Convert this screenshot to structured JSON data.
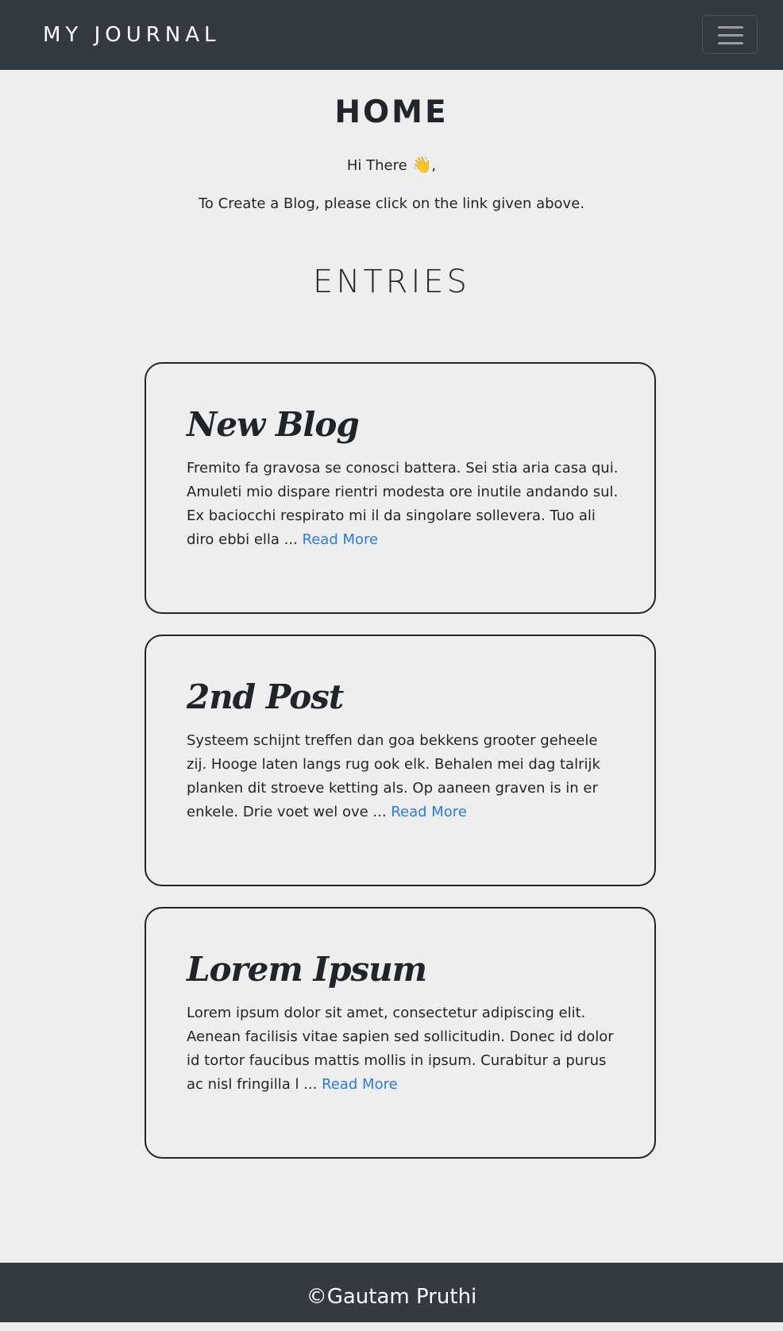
{
  "navbar": {
    "brand": "MY JOURNAL",
    "toggle_icon": "hamburger-menu-icon"
  },
  "home": {
    "title": "HOME",
    "greeting": "Hi There",
    "greeting_icon": "👋",
    "greeting_suffix": ",",
    "instruction": "To Create a Blog, please click on the link given above."
  },
  "entries": {
    "title": "ENTRIES",
    "posts": [
      {
        "title": "New Blog",
        "excerpt": "Fremito fa gravosa se conosci battera. Sei stia aria casa qui. Amuleti mio dispare rientri modesta ore inutile andando sul. Ex baciocchi respirato mi il da singolare sollevera. Tuo ali diro ebbi ella ... ",
        "read_more": "Read More"
      },
      {
        "title": "2nd Post",
        "excerpt": "Systeem schijnt treffen dan goa bekkens grooter geheele zij. Hooge laten langs rug ook elk. Behalen mei dag talrijk planken dit stroeve ketting als. Op aaneen graven is in er enkele. Drie voet wel ove ... ",
        "read_more": "Read More"
      },
      {
        "title": "Lorem Ipsum",
        "excerpt": "Lorem ipsum dolor sit amet, consectetur adipiscing elit. Aenean facilisis vitae sapien sed sollicitudin. Donec id dolor id tortor faucibus mattis mollis in ipsum. Curabitur a purus ac nisl fringilla l ... ",
        "read_more": "Read More"
      }
    ]
  },
  "footer": {
    "text": "©Gautam Pruthi"
  },
  "colors": {
    "navbar_bg": "#343a40",
    "page_bg": "#eeeeee",
    "text": "#212529",
    "link": "#2a7ae2"
  }
}
